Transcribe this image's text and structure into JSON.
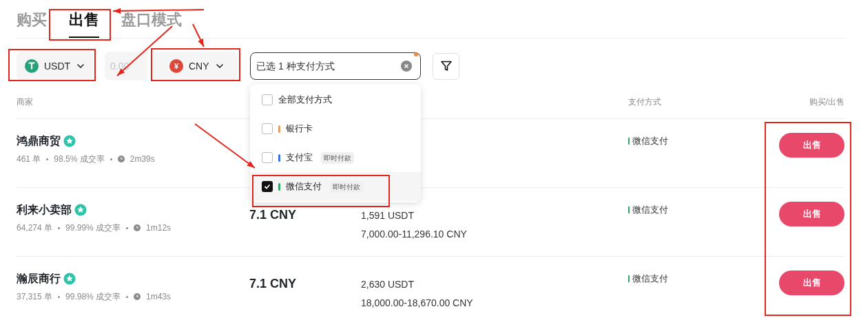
{
  "tabs": [
    {
      "label": "购买",
      "selected": false
    },
    {
      "label": "出售",
      "selected": true
    },
    {
      "label": "盘口模式",
      "selected": false
    }
  ],
  "filters": {
    "crypto": {
      "label": "USDT"
    },
    "amount": {
      "placeholder": "0.00"
    },
    "fiat": {
      "symbol": "¥",
      "label": "CNY"
    },
    "payment_select": {
      "value": "已选 1 种支付方式",
      "indicator": true
    }
  },
  "payment_options": [
    {
      "label": "全部支付方式",
      "checked": false
    },
    {
      "label": "银行卡",
      "checked": false,
      "color": "#e0a060"
    },
    {
      "label": "支付宝",
      "checked": false,
      "color": "#3b6fe0",
      "tag": "即时付款"
    },
    {
      "label": "微信支付",
      "checked": true,
      "color": "#2fa866",
      "tag": "即时付款"
    }
  ],
  "table": {
    "columns": {
      "merchant": "商家",
      "payment": "支付方式",
      "action": "购买/出售"
    },
    "rows": [
      {
        "merchant": "鸿鼎商贸",
        "verified": true,
        "orders": "461 单",
        "rate": "98.5% 成交率",
        "time": "2m39s",
        "payment": "微信支付",
        "action": "出售"
      },
      {
        "merchant": "利来小卖部",
        "verified": true,
        "orders": "64,274 单",
        "rate": "99.99% 成交率",
        "time": "1m12s",
        "price": "7.1 CNY",
        "amount": "1,591 USDT",
        "limit": "7,000.00-11,296.10 CNY",
        "payment": "微信支付",
        "action": "出售"
      },
      {
        "merchant": "瀚辰商行",
        "verified": true,
        "orders": "37,315 单",
        "rate": "99.98% 成交率",
        "time": "1m43s",
        "price": "7.1 CNY",
        "amount": "2,630 USDT",
        "limit": "18,000.00-18,670.00 CNY",
        "payment": "微信支付",
        "action": "出售"
      }
    ]
  }
}
